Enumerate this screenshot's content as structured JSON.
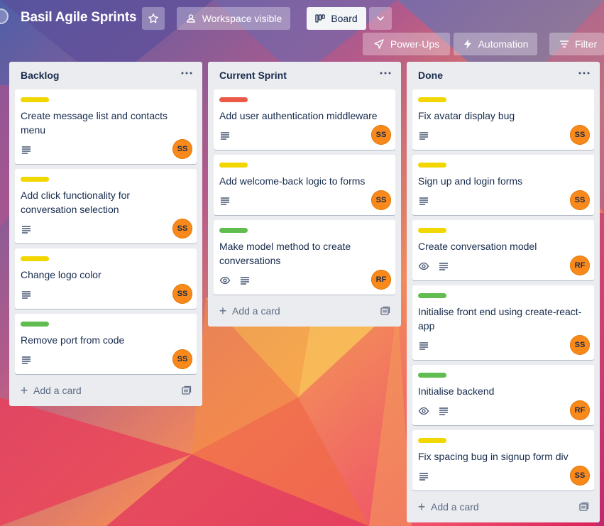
{
  "header": {
    "board_title": "Basil Agile Sprints",
    "workspace_visibility": "Workspace visible",
    "view_label": "Board",
    "powerups_label": "Power-Ups",
    "automation_label": "Automation",
    "filter_label": "Filter"
  },
  "colors": {
    "label_yellow": "#f2d600",
    "label_red": "#eb5a46",
    "label_green": "#61bd4f",
    "avatar": "#f9891a"
  },
  "lists": [
    {
      "title": "Backlog",
      "add_card_label": "Add a card",
      "cards": [
        {
          "label_color": "yellow",
          "title": "Create message list and contacts menu",
          "member": "SS",
          "watching": false
        },
        {
          "label_color": "yellow",
          "title": "Add click functionality for conversation selection",
          "member": "SS",
          "watching": false
        },
        {
          "label_color": "yellow",
          "title": "Change logo color",
          "member": "SS",
          "watching": false
        },
        {
          "label_color": "green",
          "title": "Remove port from code",
          "member": "SS",
          "watching": false
        }
      ]
    },
    {
      "title": "Current Sprint",
      "add_card_label": "Add a card",
      "cards": [
        {
          "label_color": "red",
          "title": "Add user authentication middleware",
          "member": "SS",
          "watching": false
        },
        {
          "label_color": "yellow",
          "title": "Add welcome-back logic to forms",
          "member": "SS",
          "watching": false
        },
        {
          "label_color": "green",
          "title": "Make model method to create conversations",
          "member": "RF",
          "watching": true
        }
      ]
    },
    {
      "title": "Done",
      "add_card_label": "Add a card",
      "cards": [
        {
          "label_color": "yellow",
          "title": "Fix avatar display bug",
          "member": "SS",
          "watching": false
        },
        {
          "label_color": "yellow",
          "title": "Sign up and login forms",
          "member": "SS",
          "watching": false
        },
        {
          "label_color": "yellow",
          "title": "Create conversation model",
          "member": "RF",
          "watching": true
        },
        {
          "label_color": "green",
          "title": "Initialise front end using create-react-app",
          "member": "SS",
          "watching": false
        },
        {
          "label_color": "green",
          "title": "Initialise backend",
          "member": "RF",
          "watching": true
        },
        {
          "label_color": "yellow",
          "title": "Fix spacing bug in signup form div",
          "member": "SS",
          "watching": false
        }
      ]
    }
  ],
  "icons": {
    "star": "star-icon",
    "workspace": "people-icon",
    "board": "board-icon",
    "chevron": "chevron-down-icon",
    "powerups": "rocket-icon",
    "automation": "lightning-icon",
    "filter": "filter-icon",
    "description": "description-icon",
    "watch": "eye-icon",
    "list_menu": "more-icon",
    "template": "card-template-icon",
    "add": "plus-icon"
  }
}
